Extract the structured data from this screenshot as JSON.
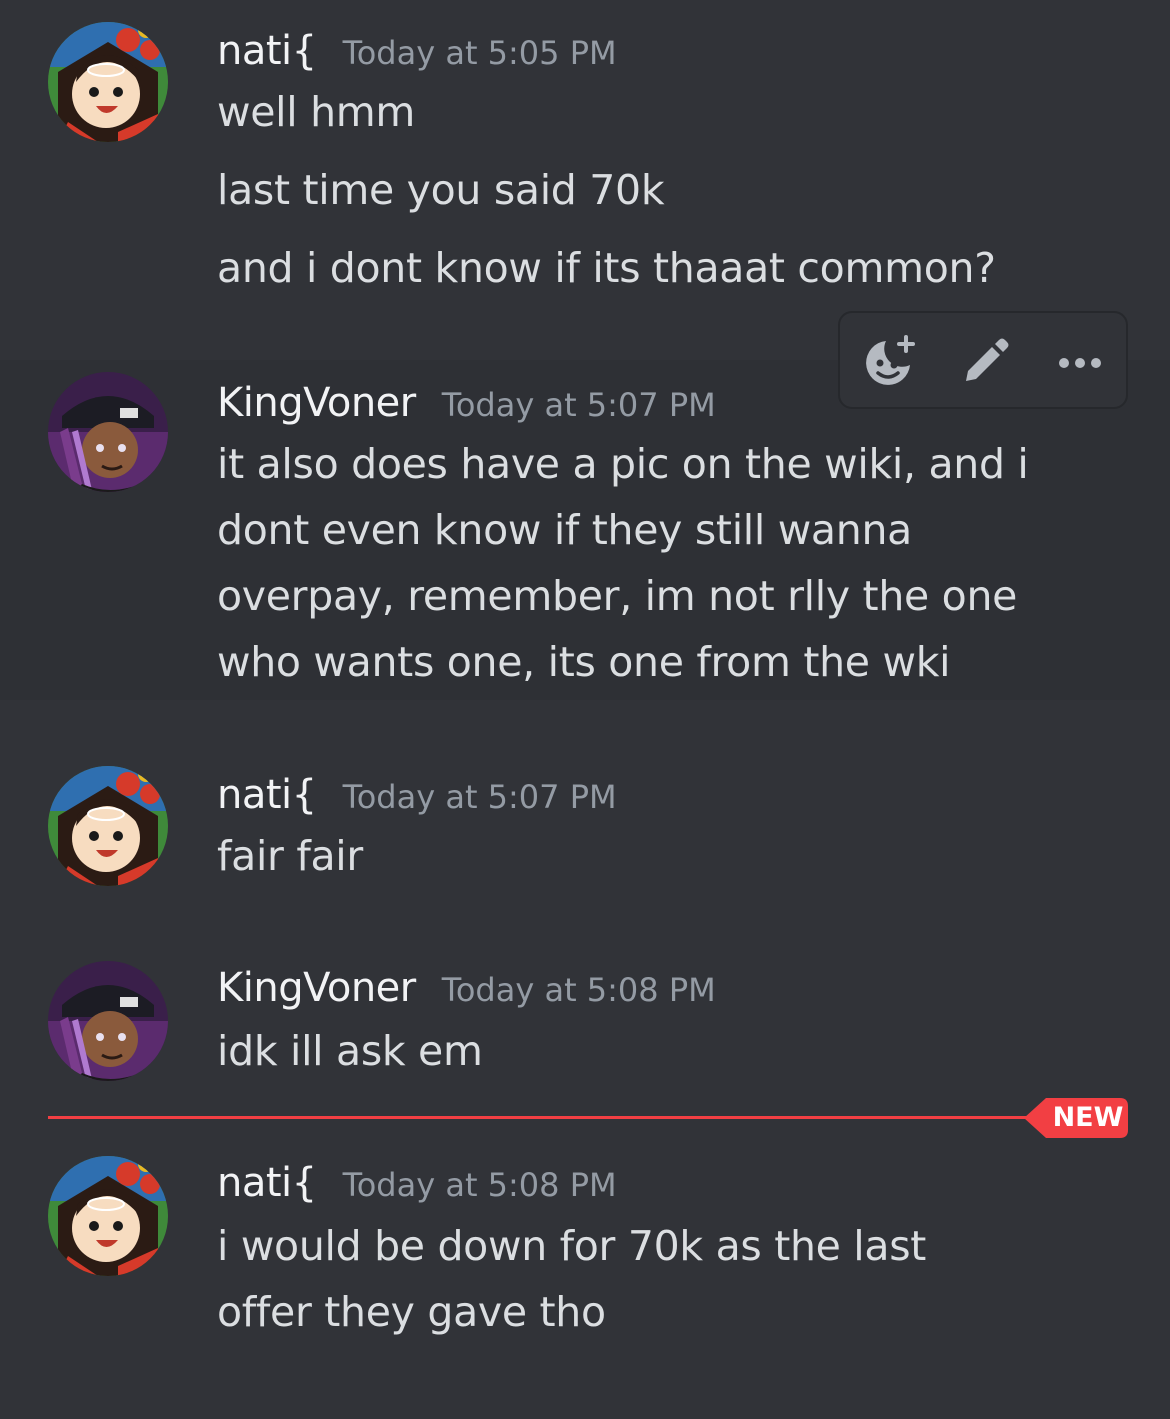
{
  "messages": [
    {
      "author": "nati{",
      "timestamp": "Today at 5:05 PM",
      "avatar_icon": "cartoon-character-avatar",
      "lines": [
        "well hmm",
        "last time you said 70k",
        "and i dont know if its thaaat common?"
      ]
    },
    {
      "author": "KingVoner",
      "timestamp": "Today at 5:07 PM",
      "avatar_icon": "anime-character-avatar",
      "lines": [
        "it also does have a pic on the wiki, and i",
        "dont even know if they still wanna",
        "overpay, remember, im not rlly the one",
        "who wants one, its one from the wki"
      ]
    },
    {
      "author": "nati{",
      "timestamp": "Today at 5:07 PM",
      "avatar_icon": "cartoon-character-avatar",
      "lines": [
        "fair fair"
      ]
    },
    {
      "author": "KingVoner",
      "timestamp": "Today at 5:08 PM",
      "avatar_icon": "anime-character-avatar",
      "lines": [
        "idk ill ask em"
      ]
    },
    {
      "author": "nati{",
      "timestamp": "Today at 5:08 PM",
      "avatar_icon": "cartoon-character-avatar",
      "lines": [
        "i would be down for 70k as the last",
        "offer they gave tho"
      ]
    }
  ],
  "hover_toolbar": {
    "icons": [
      "add-reaction-icon",
      "edit-pencil-icon",
      "more-options-icon"
    ]
  },
  "new_divider": {
    "label": "NEW",
    "color": "#f23f43"
  },
  "colors": {
    "background": "#313338",
    "username": "#f2f3f5",
    "timestamp": "#949ba4",
    "message_text": "#dbdee1"
  }
}
